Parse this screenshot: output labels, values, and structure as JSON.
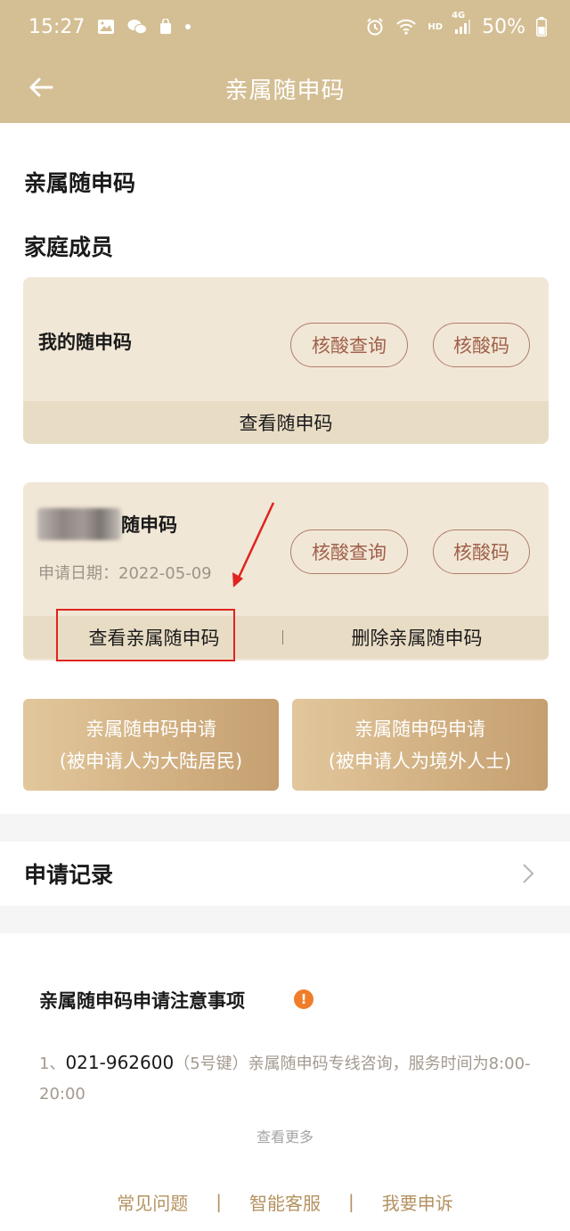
{
  "status_bar": {
    "time": "15:27",
    "left_icons": [
      "gallery-icon",
      "wechat-icon",
      "shopping-bag-icon",
      "dot-icon"
    ],
    "hd": "HD",
    "network": "4G",
    "battery": "50%"
  },
  "app_bar": {
    "title": "亲属随申码",
    "back_icon": "arrow-left-icon"
  },
  "section_title": "亲属随申码",
  "family_title": "家庭成员",
  "my_card": {
    "name": "我的随申码",
    "btn_nucleic_query": "核酸查询",
    "btn_nucleic_code": "核酸码",
    "footer": "查看随申码"
  },
  "relative_card": {
    "name_suffix": "随申码",
    "date": "申请日期：2022-05-09",
    "btn_nucleic_query": "核酸查询",
    "btn_nucleic_code": "核酸码",
    "view_btn": "查看亲属随申码",
    "delete_btn": "删除亲属随申码"
  },
  "apply_buttons": [
    {
      "line1": "亲属随申码申请",
      "line2": "(被申请人为大陆居民)"
    },
    {
      "line1": "亲属随申码申请",
      "line2": "(被申请人为境外人士)"
    }
  ],
  "records": {
    "title": "申请记录"
  },
  "notice": {
    "title": "亲属随申码申请注意事项",
    "prefix": "1、",
    "phone": "021-962600",
    "text": "（5号键）亲属随申码专线咨询，服务时间为8:00-20:00",
    "see_more": "查看更多"
  },
  "bottom_links": [
    "常见问题",
    "智能客服",
    "我要申诉"
  ],
  "colors": {
    "header": "#d4bf94",
    "card_bg": "#f1e7d6",
    "card_footer": "#e8dcc5",
    "pill_text": "#a0604b",
    "accent_link": "#b49260",
    "highlight": "#e0231f"
  }
}
